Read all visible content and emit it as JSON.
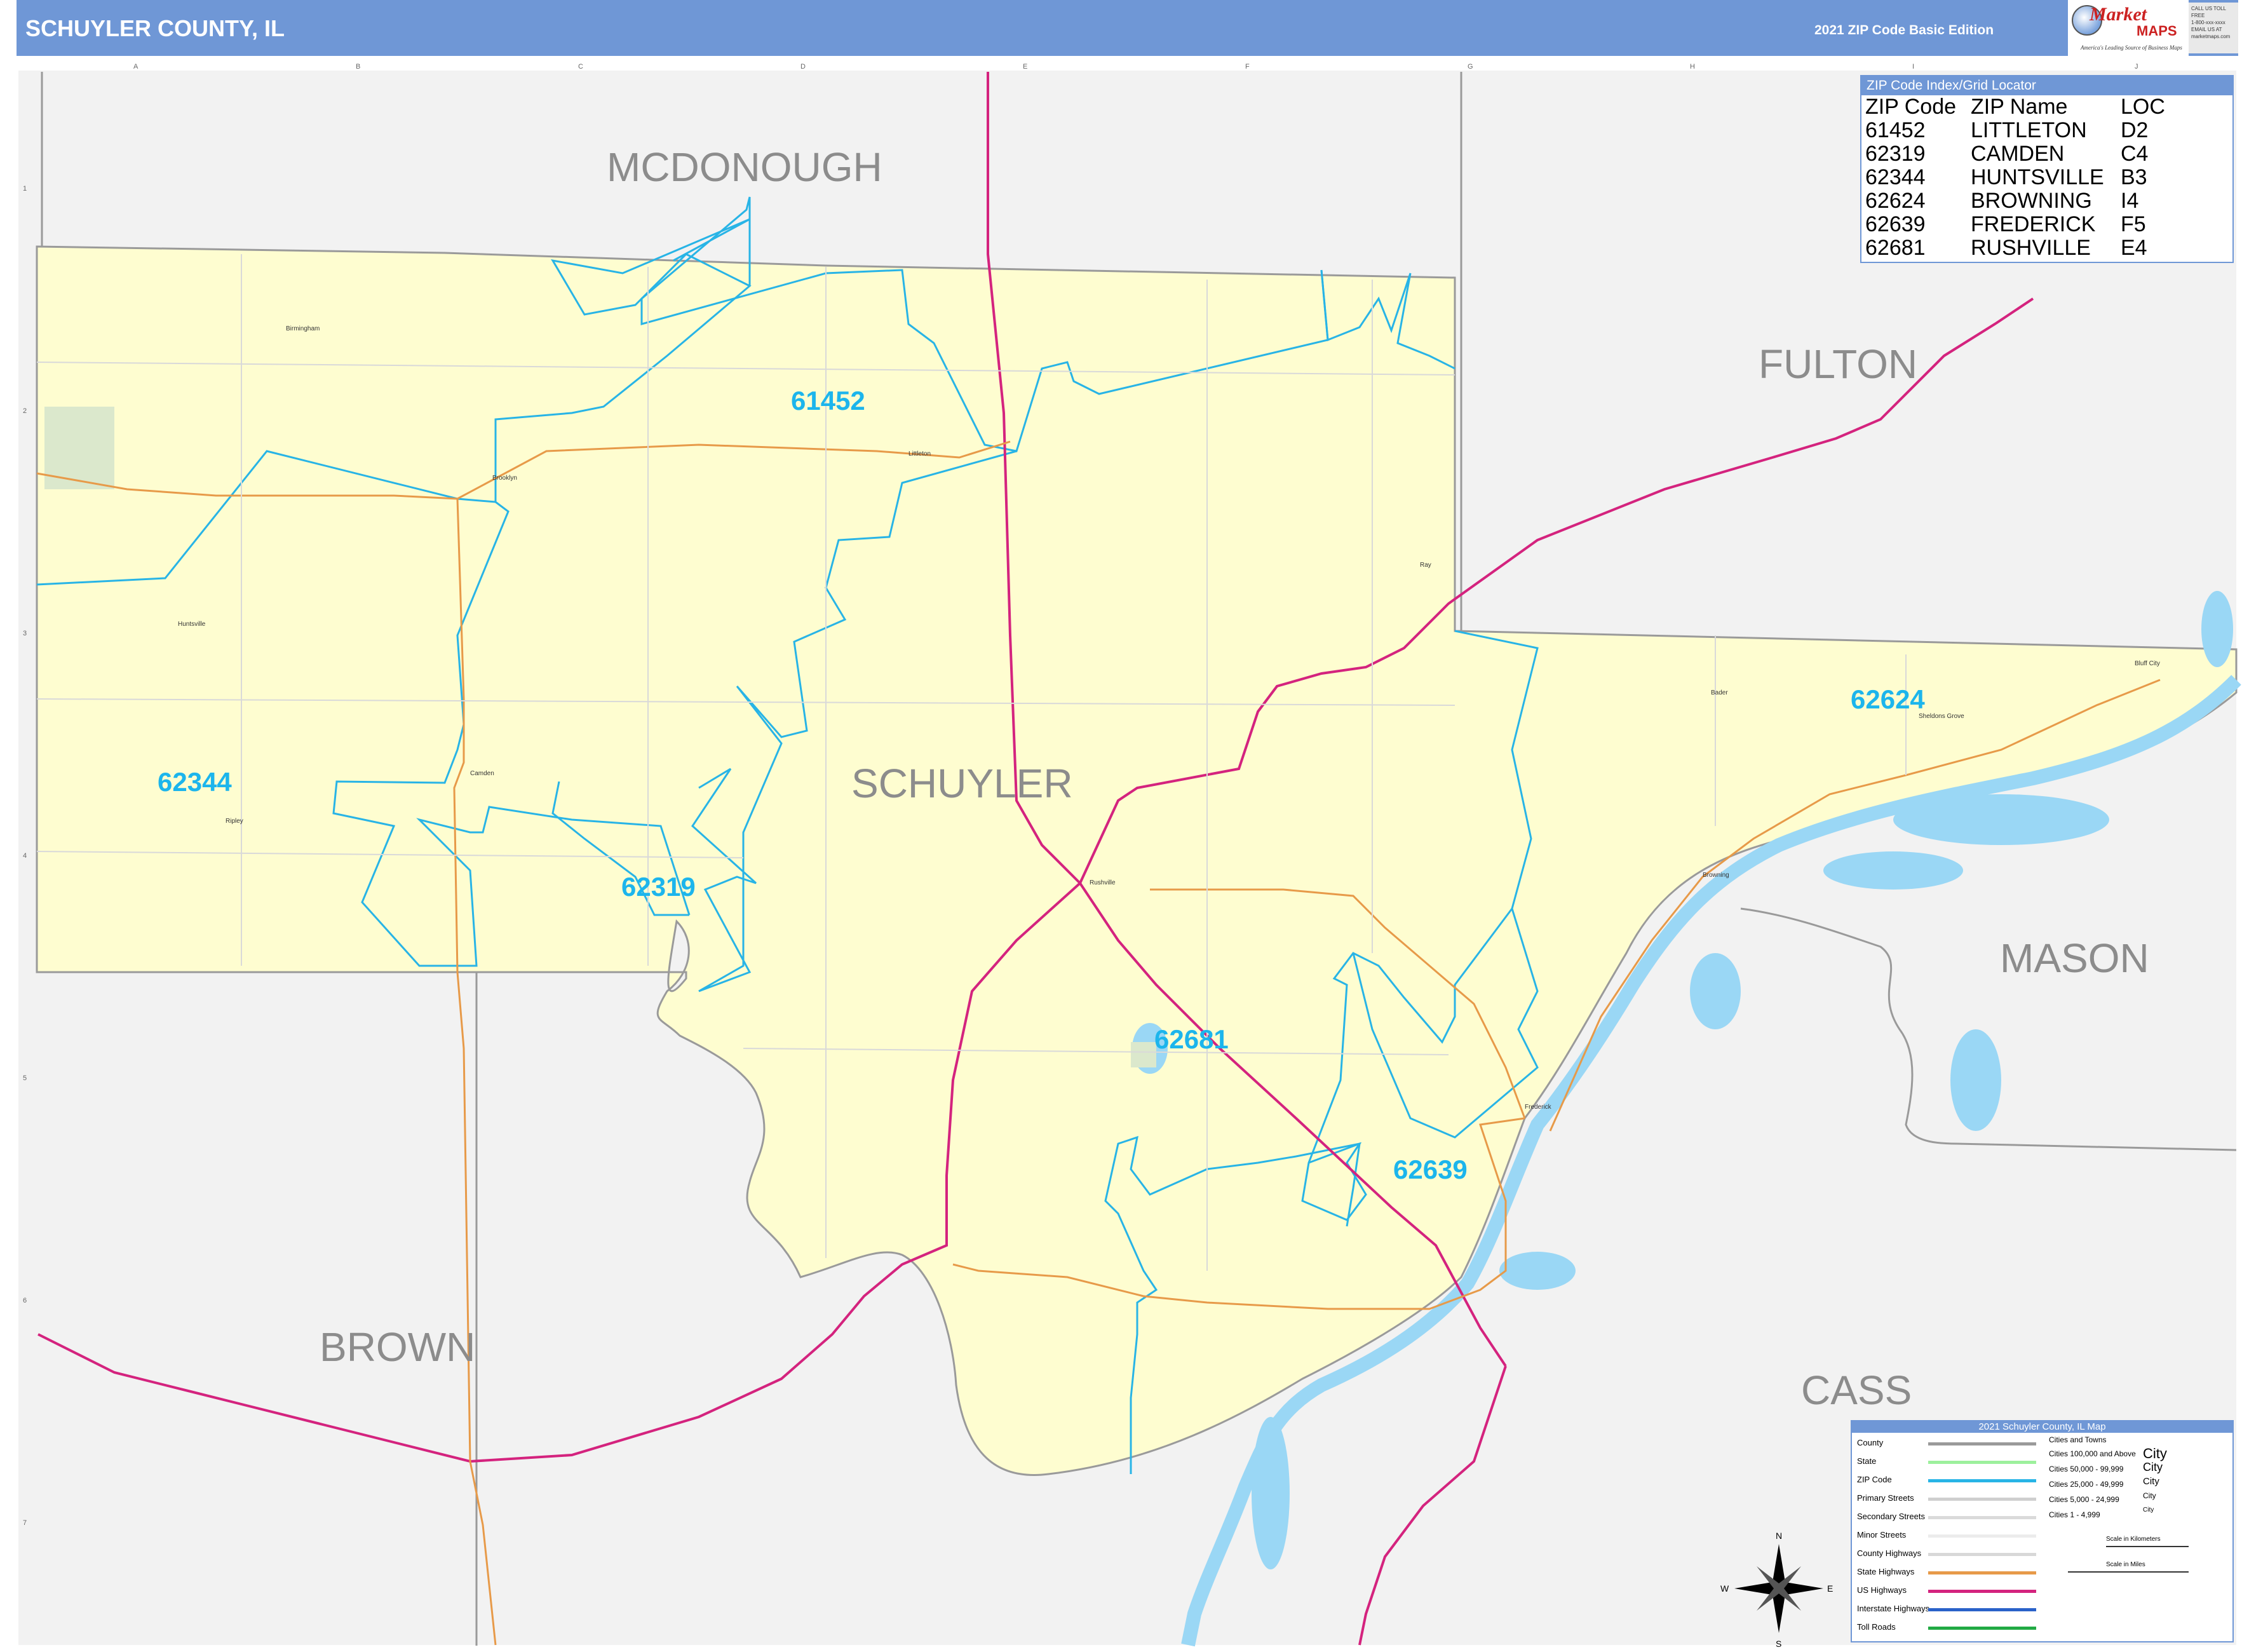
{
  "header": {
    "title": "SCHUYLER COUNTY, IL",
    "edition": "2021 ZIP Code Basic Edition"
  },
  "logo": {
    "name_first": "Market",
    "name_second": "MAPS",
    "tagline": "America's Leading Source of Business Maps",
    "contact_lines": [
      "CALL US TOLL FREE",
      "1-800-xxx-xxxx",
      "EMAIL US AT",
      "marketmaps.com"
    ]
  },
  "map": {
    "counties": [
      {
        "name": "MCDONOUGH"
      },
      {
        "name": "FULTON"
      },
      {
        "name": "SCHUYLER"
      },
      {
        "name": "MASON"
      },
      {
        "name": "BROWN"
      },
      {
        "name": "CASS"
      }
    ],
    "zip_labels": [
      {
        "code": "61452"
      },
      {
        "code": "62344"
      },
      {
        "code": "62319"
      },
      {
        "code": "62624"
      },
      {
        "code": "62681"
      },
      {
        "code": "62639"
      }
    ],
    "places": [
      {
        "name": "Birmingham"
      },
      {
        "name": "Brooklyn"
      },
      {
        "name": "Littleton"
      },
      {
        "name": "Huntsville"
      },
      {
        "name": "Camden"
      },
      {
        "name": "Rushville"
      },
      {
        "name": "Ray"
      },
      {
        "name": "Bader"
      },
      {
        "name": "Bluff City"
      },
      {
        "name": "Sheldons Grove"
      },
      {
        "name": "Browning"
      },
      {
        "name": "Frederick"
      },
      {
        "name": "Ripley"
      }
    ],
    "grid_columns": [
      "A",
      "B",
      "C",
      "D",
      "E",
      "F",
      "G",
      "H",
      "I",
      "J"
    ],
    "grid_rows": [
      "1",
      "2",
      "3",
      "4",
      "5",
      "6",
      "7"
    ],
    "compass": {
      "n": "N",
      "s": "S",
      "e": "E",
      "w": "W"
    },
    "colors": {
      "county_fill": "#fefdd0",
      "outside_fill": "#f2f2f2",
      "zip_boundary": "#28b4e6",
      "us_highway": "#d4237e",
      "state_highway": "#e79a49",
      "water": "#9ad7f5",
      "county_line": "#999999",
      "zip_label": "#1cb5ec",
      "county_label": "#8c8c8c"
    }
  },
  "zip_index": {
    "title": "ZIP Code Index/Grid Locator",
    "headers": [
      "ZIP Code",
      "ZIP Name",
      "LOC"
    ],
    "rows": [
      [
        "61452",
        "LITTLETON",
        "D2"
      ],
      [
        "62319",
        "CAMDEN",
        "C4"
      ],
      [
        "62344",
        "HUNTSVILLE",
        "B3"
      ],
      [
        "62624",
        "BROWNING",
        "I4"
      ],
      [
        "62639",
        "FREDERICK",
        "F5"
      ],
      [
        "62681",
        "RUSHVILLE",
        "E4"
      ]
    ]
  },
  "legend": {
    "title": "2021 Schuyler County, IL Map",
    "items": [
      {
        "label": "County",
        "color": "#9a9a9a"
      },
      {
        "label": "State",
        "color": "#9df09d"
      },
      {
        "label": "ZIP Code",
        "color": "#28b4e6"
      },
      {
        "label": "Primary Streets",
        "color": "#cfcfcf"
      },
      {
        "label": "Secondary Streets",
        "color": "#dadada"
      },
      {
        "label": "Minor Streets",
        "color": "#ececec"
      },
      {
        "label": "County Highways",
        "color": "#d8d8d8"
      },
      {
        "label": "State Highways",
        "color": "#e79a49"
      },
      {
        "label": "US Highways",
        "color": "#d4237e"
      },
      {
        "label": "Interstate Highways",
        "color": "#2a62c9"
      },
      {
        "label": "Toll Roads",
        "color": "#22aa44"
      }
    ],
    "cities_title": "Cities and Towns",
    "cities": [
      {
        "label": "Cities 100,000 and Above",
        "mark": "City"
      },
      {
        "label": "Cities 50,000 - 99,999",
        "mark": "City"
      },
      {
        "label": "Cities 25,000 - 49,999",
        "mark": "City"
      },
      {
        "label": "Cities 5,000 - 24,999",
        "mark": "City"
      },
      {
        "label": "Cities 1 - 4,999",
        "mark": "City"
      }
    ],
    "scale_km": "Scale in Kilometers",
    "scale_mi": "Scale in Miles"
  }
}
